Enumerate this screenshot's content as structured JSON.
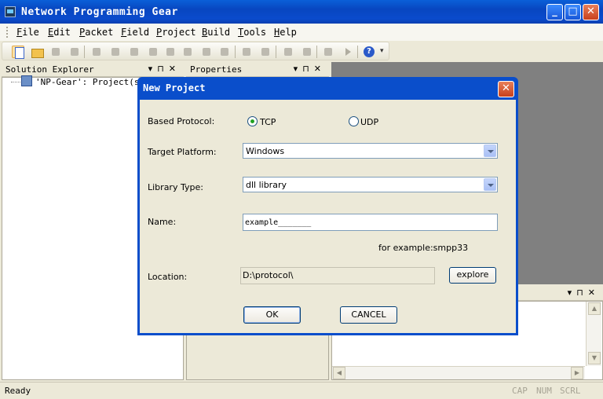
{
  "window": {
    "title": "Network Programming Gear"
  },
  "menu": [
    "File",
    "Edit",
    "Packet",
    "Field",
    "Project",
    "Build",
    "Tools",
    "Help"
  ],
  "menu_accelerators": [
    "F",
    "E",
    "P",
    "F",
    "P",
    "B",
    "T",
    "H"
  ],
  "solution_explorer": {
    "title": "Solution Explorer",
    "tree_root": "'NP-Gear': Project(s)"
  },
  "properties": {
    "title": "Properties"
  },
  "status": {
    "text": "Ready",
    "indicators": [
      "CAP",
      "NUM",
      "SCRL"
    ]
  },
  "dialog": {
    "title": "New Project",
    "based_protocol_label": "Based Protocol:",
    "protocol_options": [
      "TCP",
      "UDP"
    ],
    "selected_protocol": "TCP",
    "target_platform_label": "Target Platform:",
    "target_platform_value": "Windows",
    "library_type_label": "Library Type:",
    "library_type_value": "dll library",
    "name_label": "Name:",
    "name_value": "example_______",
    "name_hint": "for example:smpp33",
    "location_label": "Location:",
    "location_value": "D:\\protocol\\",
    "explore_label": "explore",
    "ok_label": "OK",
    "cancel_label": "CANCEL"
  },
  "colors": {
    "titlebar": "#0846c0",
    "dialog_frame": "#0a4ecb",
    "dialog_body": "#ece9d8",
    "close_button": "#c8401c"
  }
}
